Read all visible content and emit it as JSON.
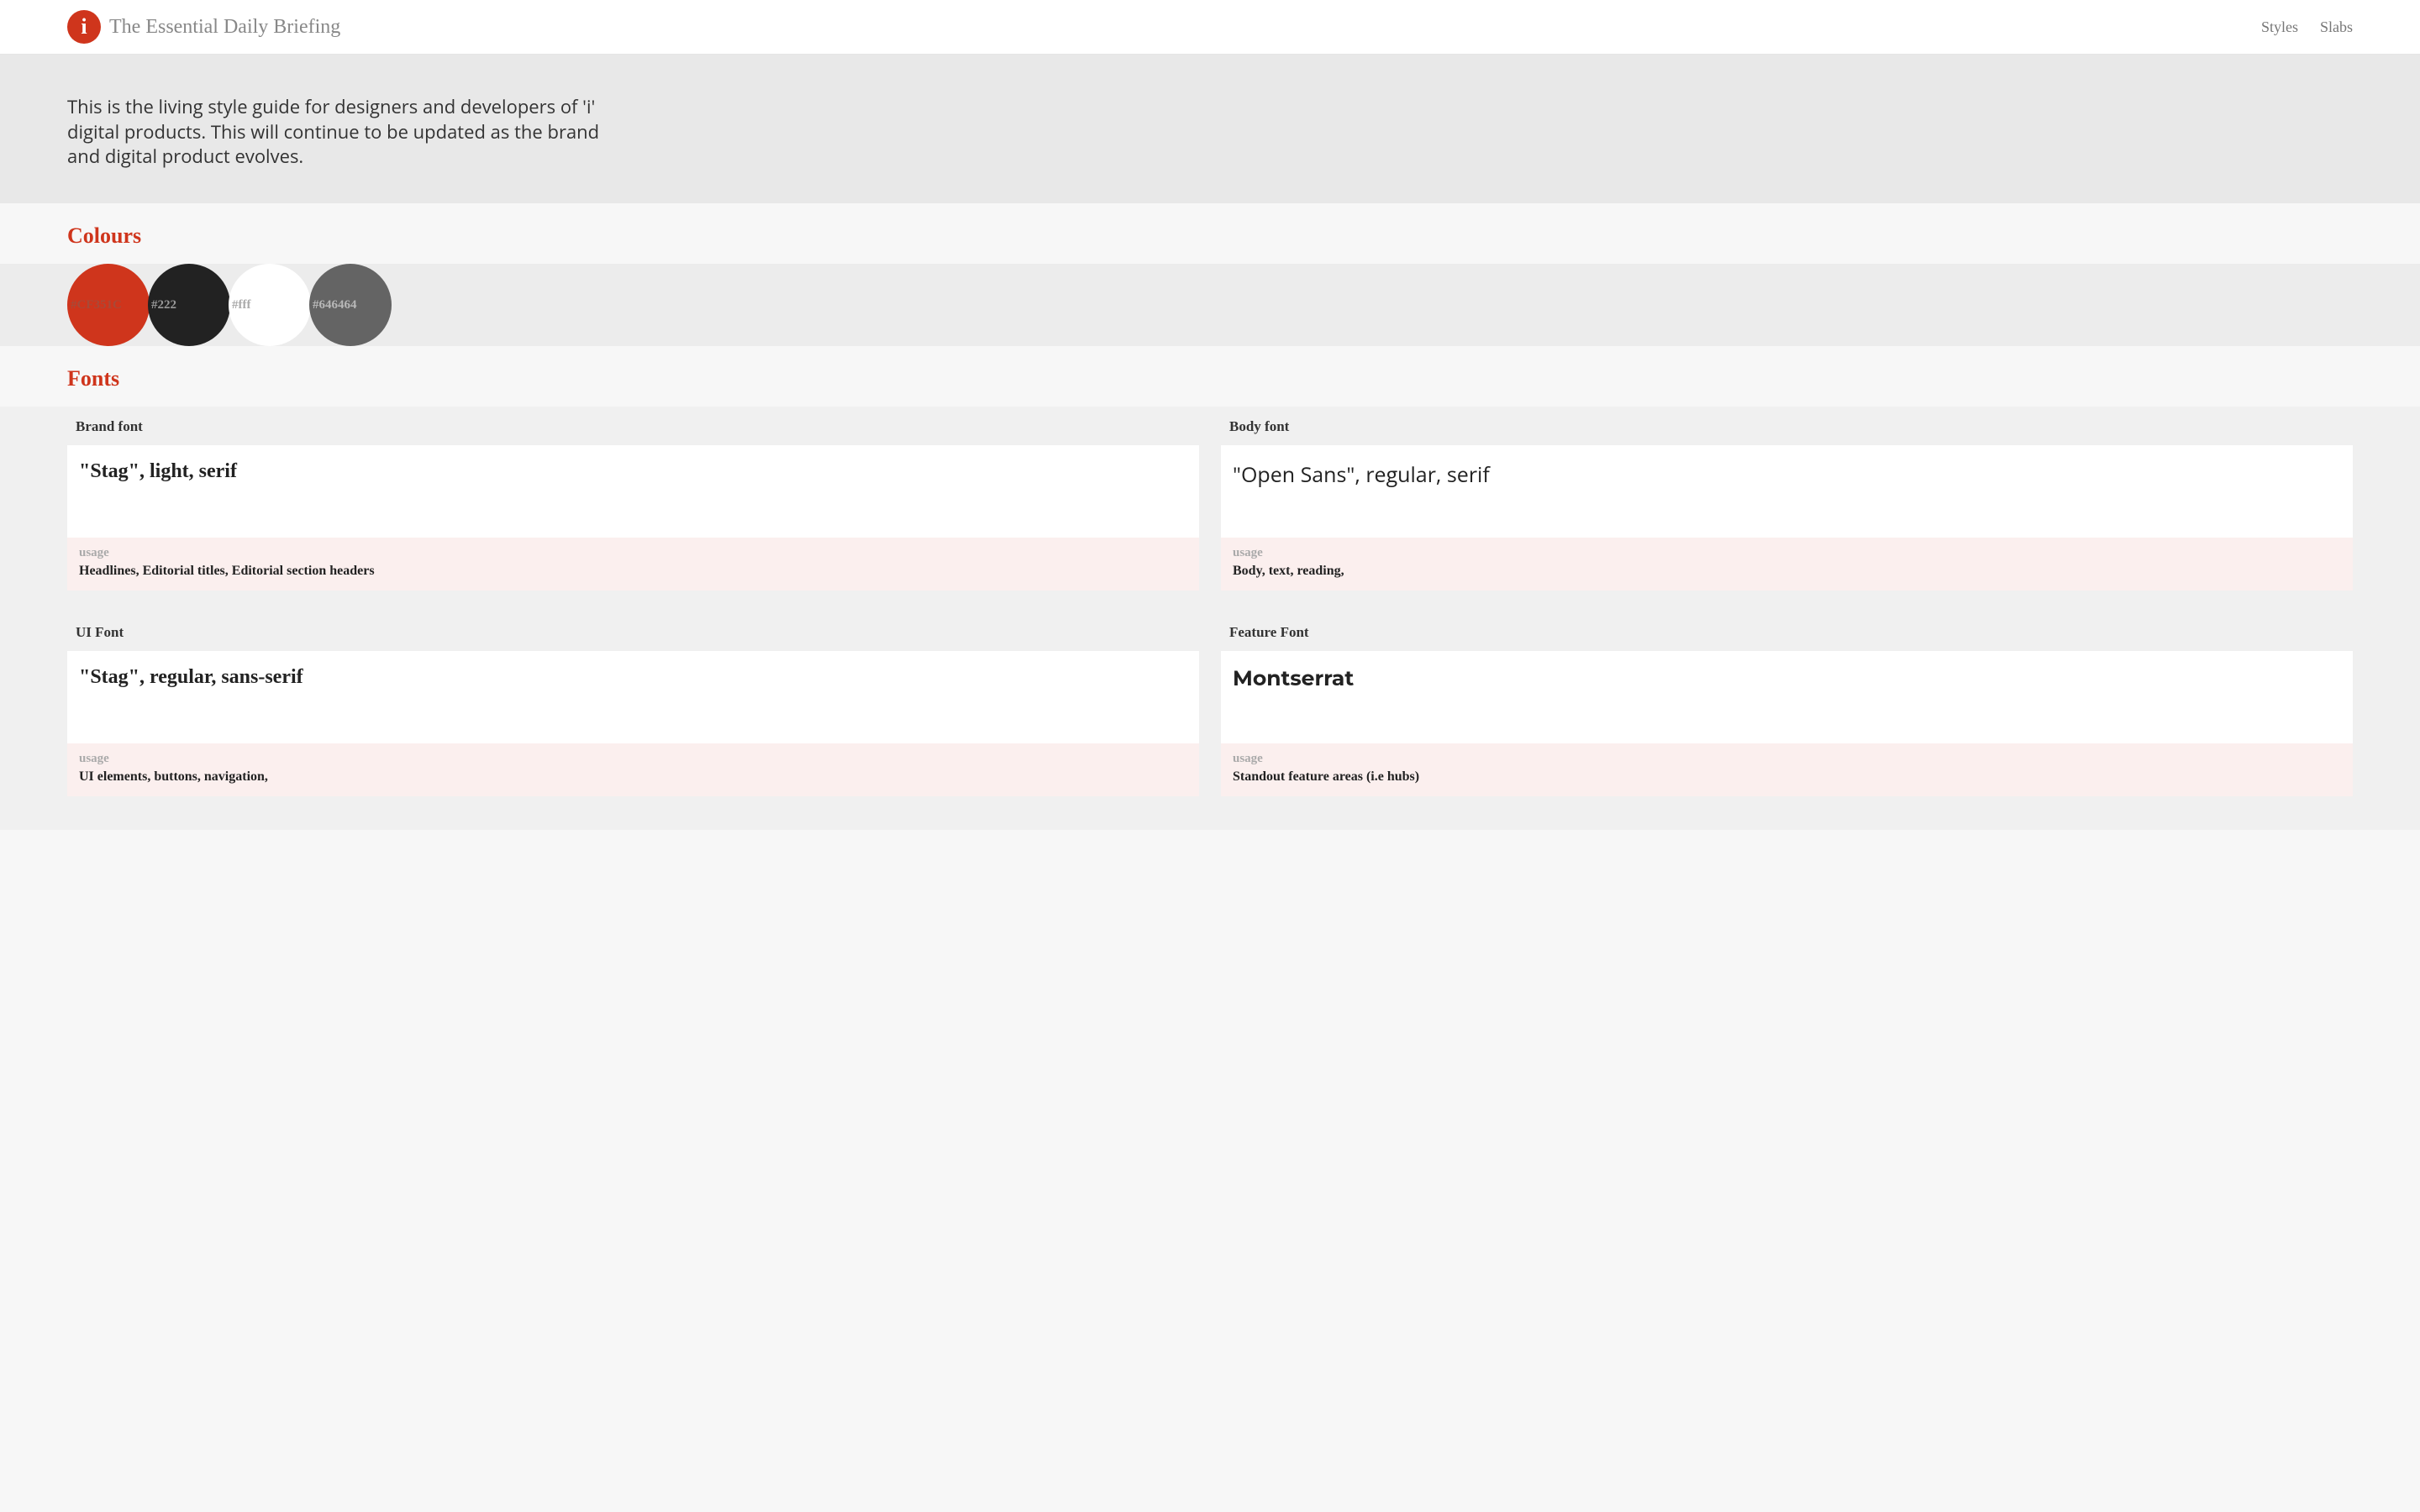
{
  "header": {
    "logo_letter": "i",
    "brand": "The Essential Daily Briefing",
    "nav": {
      "styles": "Styles",
      "slabs": "Slabs"
    }
  },
  "intro": "This is the living style guide for designers and developers of 'i' digital products. This will continue to be updated as the brand and digital product evolves.",
  "sections": {
    "colours_title": "Colours",
    "fonts_title": "Fonts"
  },
  "colours": [
    {
      "hex": "#CF351C"
    },
    {
      "hex": "#222"
    },
    {
      "hex": "#fff"
    },
    {
      "hex": "#646464"
    }
  ],
  "fonts": {
    "brand": {
      "label": "Brand font",
      "sample": "\"Stag\", light, serif",
      "usage_label": "usage",
      "usage": "Headlines, Editorial titles, Editorial section headers"
    },
    "body": {
      "label": "Body font",
      "sample": "\"Open Sans\", regular, serif",
      "usage_label": "usage",
      "usage": "Body, text, reading,"
    },
    "ui": {
      "label": "UI Font",
      "sample": "\"Stag\", regular, sans-serif",
      "usage_label": "usage",
      "usage": "UI elements, buttons, navigation,"
    },
    "feature": {
      "label": "Feature Font",
      "sample": "Montserrat",
      "usage_label": "usage",
      "usage": "Standout feature areas (i.e hubs)"
    }
  }
}
